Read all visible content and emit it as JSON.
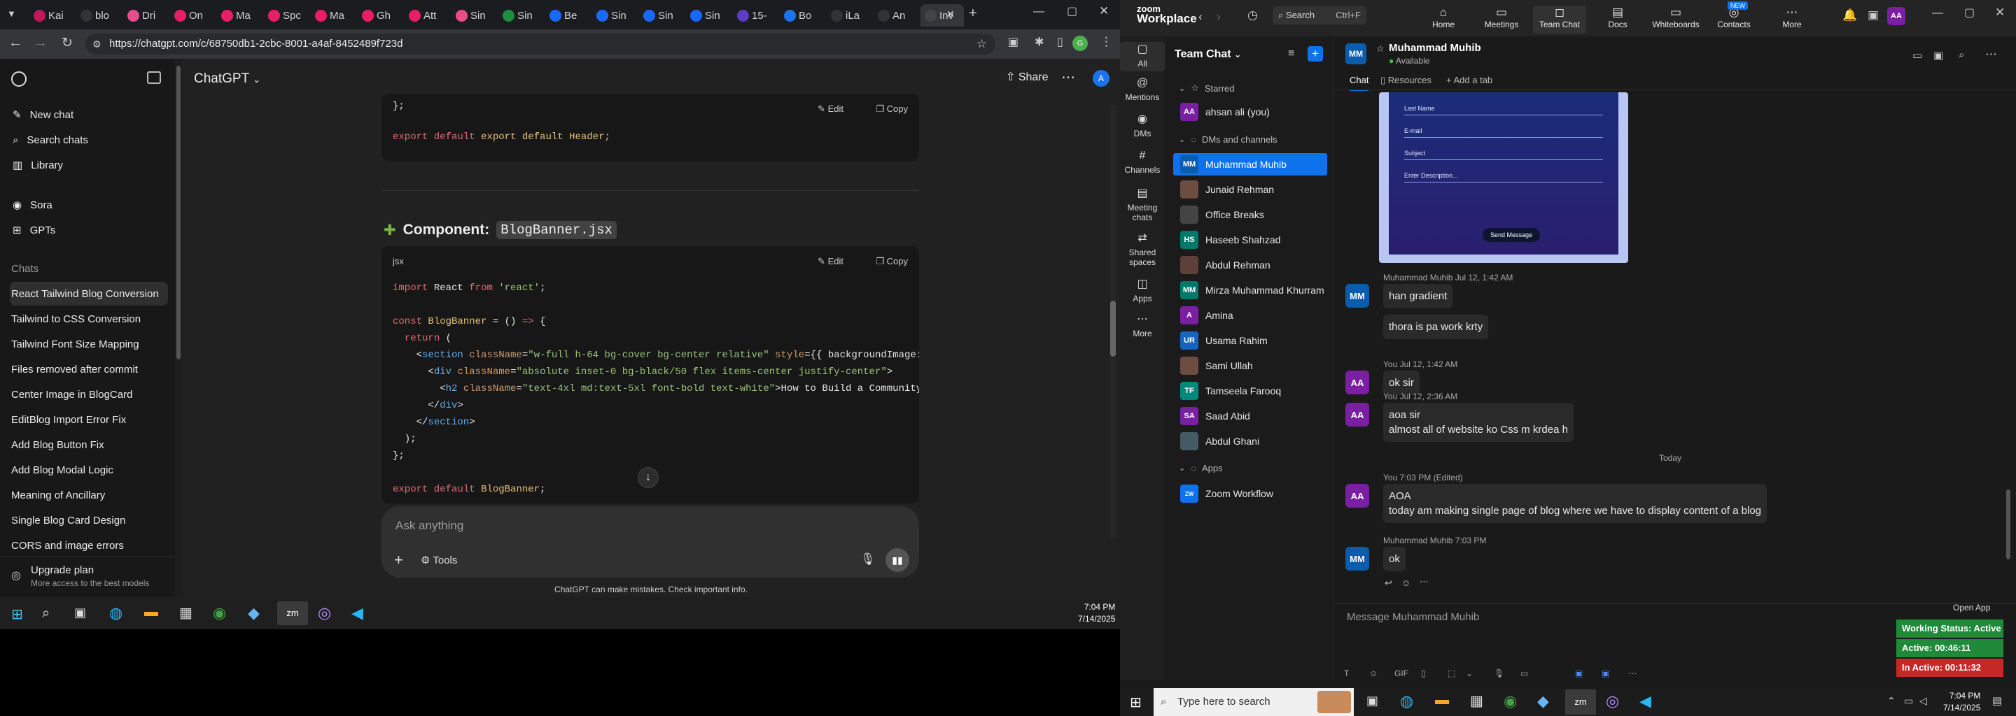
{
  "colors": {
    "accent": "#0e72ed",
    "gpt_bg": "#212121",
    "zoom_bg": "#1a1a1a",
    "status_active": "#1f8a3a",
    "status_inactive": "#c62828"
  },
  "chrome": {
    "tabs": [
      {
        "label": "Kai",
        "icon": "chrome-tab-icon",
        "color": "#c2185b"
      },
      {
        "label": "blo",
        "icon": "github-icon",
        "color": "#333333"
      },
      {
        "label": "Dri",
        "icon": "dribbble-icon",
        "color": "#ea4c89"
      },
      {
        "label": "On",
        "icon": "heart-icon",
        "color": "#e91e63"
      },
      {
        "label": "Ma",
        "icon": "heart-icon",
        "color": "#e91e63"
      },
      {
        "label": "Spc",
        "icon": "heart-icon",
        "color": "#e91e63"
      },
      {
        "label": "Ma",
        "icon": "heart-icon",
        "color": "#e91e63"
      },
      {
        "label": "Gh",
        "icon": "heart-icon",
        "color": "#e91e63"
      },
      {
        "label": "Att",
        "icon": "heart-icon",
        "color": "#e91e63"
      },
      {
        "label": "Sin",
        "icon": "dribbble-icon",
        "color": "#ea4c89"
      },
      {
        "label": "Sin",
        "icon": "sheets-icon",
        "color": "#1e8e3e"
      },
      {
        "label": "Be",
        "icon": "behance-icon",
        "color": "#1769ff"
      },
      {
        "label": "Sin",
        "icon": "sheets-icon",
        "color": "#1769ff"
      },
      {
        "label": "Sin",
        "icon": "sheets-icon",
        "color": "#1769ff"
      },
      {
        "label": "Sin",
        "icon": "sheets-icon",
        "color": "#1769ff"
      },
      {
        "label": "15-",
        "icon": "a-icon",
        "color": "#5b3cc4"
      },
      {
        "label": "Bo",
        "icon": "bookmark-icon",
        "color": "#1a73e8"
      },
      {
        "label": "iLa",
        "icon": "github-icon",
        "color": "#333333"
      },
      {
        "label": "An",
        "icon": "github-icon",
        "color": "#333333"
      },
      {
        "label": "Inv",
        "icon": "chatgpt-icon",
        "color": "#444444"
      }
    ],
    "url": "https://chatgpt.com/c/68750db1-2cbc-8001-a4af-8452489f723d"
  },
  "gpt": {
    "model": "ChatGPT",
    "share_label": "Share",
    "avatar": "A",
    "sidebar_top": [
      "New chat",
      "Search chats",
      "Library"
    ],
    "sidebar_mid": [
      "Sora",
      "GPTs"
    ],
    "chats_header": "Chats",
    "chats": [
      "React Tailwind Blog Conversion",
      "Tailwind to CSS Conversion",
      "Tailwind Font Size Mapping",
      "Files removed after commit",
      "Center Image in BlogCard",
      "EditBlog Import Error Fix",
      "Add Blog Button Fix",
      "Add Blog Modal Logic",
      "Meaning of Ancillary",
      "Single Blog Card Design",
      "CORS and image errors"
    ],
    "upgrade_title": "Upgrade plan",
    "upgrade_sub": "More access to the best models",
    "copy_label": "Copy",
    "edit_label": "Edit",
    "code1_end": "};",
    "code1_export": "export default Header;",
    "component_label": "Component:",
    "component_name": "BlogBanner.jsx",
    "lang": "jsx",
    "input_placeholder": "Ask anything",
    "tools_label": "Tools",
    "disclaimer": "ChatGPT can make mistakes. Check important info.",
    "time": "7:04 PM",
    "date": "7/14/2025"
  },
  "zoom": {
    "brand1": "zoom",
    "brand2": "Workplace",
    "search_label": "Search",
    "search_shortcut": "Ctrl+F",
    "nav": [
      {
        "label": "Home",
        "icon": "home-icon",
        "glyph": "⌂"
      },
      {
        "label": "Meetings",
        "icon": "camera-icon",
        "glyph": "▭"
      },
      {
        "label": "Team Chat",
        "icon": "chat-icon",
        "glyph": "◻"
      },
      {
        "label": "Docs",
        "icon": "docs-icon",
        "glyph": "▤"
      },
      {
        "label": "Whiteboards",
        "icon": "whiteboard-icon",
        "glyph": "▭"
      },
      {
        "label": "Contacts",
        "icon": "contacts-icon",
        "glyph": "◎"
      },
      {
        "label": "More",
        "icon": "more-icon",
        "glyph": "⋯"
      }
    ],
    "new_badge": "NEW",
    "user_avatar": "AA",
    "rail": [
      {
        "label": "All",
        "glyph": "▢"
      },
      {
        "label": "Mentions",
        "glyph": "@"
      },
      {
        "label": "DMs",
        "glyph": "◉"
      },
      {
        "label": "Channels",
        "glyph": "#"
      },
      {
        "label": "Meeting chats",
        "glyph": "▤"
      },
      {
        "label": "Shared spaces",
        "glyph": "⇄"
      },
      {
        "label": "Apps",
        "glyph": "◫"
      },
      {
        "label": "More",
        "glyph": "⋯"
      }
    ],
    "team_chat_title": "Team Chat",
    "starred": "Starred",
    "self_contact": "ahsan ali (you)",
    "dms_header": "DMs and channels",
    "contacts": [
      {
        "name": "Muhammad Muhib",
        "initials": "MM",
        "color": "#0b5cad"
      },
      {
        "name": "Junaid Rehman",
        "initials": "",
        "color": "#6d4c41"
      },
      {
        "name": "Office Breaks",
        "initials": "",
        "color": "#444444"
      },
      {
        "name": "Haseeb Shahzad",
        "initials": "HS",
        "color": "#00796b"
      },
      {
        "name": "Abdul Rehman",
        "initials": "",
        "color": "#5d4037"
      },
      {
        "name": "Mirza Muhammad Khurram",
        "initials": "MM",
        "color": "#00796b"
      },
      {
        "name": "Amina",
        "initials": "A",
        "color": "#7b1fa2"
      },
      {
        "name": "Usama Rahim",
        "initials": "UR",
        "color": "#1565c0"
      },
      {
        "name": "Sami Ullah",
        "initials": "",
        "color": "#6d4c41"
      },
      {
        "name": "Tamseela Farooq",
        "initials": "TF",
        "color": "#00897b"
      },
      {
        "name": "Saad Abid",
        "initials": "SA",
        "color": "#7b1fa2"
      },
      {
        "name": "Abdul Ghani",
        "initials": "",
        "color": "#455a64"
      }
    ],
    "apps_header": "Apps",
    "app_item": "Zoom Workflow",
    "chat_header_name": "Muhammad Muhib",
    "chat_status": "Available",
    "tabs": [
      "Chat",
      "Resources",
      "Add a tab"
    ],
    "form_fields": [
      "Last Name",
      "E-mail",
      "Subject",
      "Enter Description..."
    ],
    "form_button": "Send Message",
    "messages": [
      {
        "meta": "Muhammad Muhib Jul 12, 1:42 AM",
        "avatar": "MM",
        "lines": [
          "han gradient"
        ]
      },
      {
        "meta": "",
        "avatar": "",
        "lines": [
          "thora is pa work krty"
        ]
      },
      {
        "meta": "You Jul 12, 1:42 AM",
        "avatar": "AA",
        "lines": [
          "ok sir"
        ]
      },
      {
        "meta": "You Jul 12, 2:36 AM",
        "avatar": "AA",
        "lines": [
          "aoa sir",
          "almost all of website ko Css m krdea h"
        ]
      },
      {
        "meta": "You 7:03 PM (Edited)",
        "avatar": "AA",
        "lines": [
          "AOA",
          "today am making single page of blog where we have to display content of a blog"
        ]
      },
      {
        "meta": "Muhammad Muhib 7:03 PM",
        "avatar": "MM",
        "lines": [
          "ok"
        ]
      }
    ],
    "day_divider": "Today",
    "composer_placeholder": "Message Muhammad Muhib",
    "open_app": "Open App",
    "working_status": "Working Status: Active",
    "active_time": "Active: 00:46:11",
    "inactive_time": "In Active: 00:11:32",
    "search_taskbar": "Type here to search",
    "time": "7:04 PM",
    "date": "7/14/2025"
  }
}
